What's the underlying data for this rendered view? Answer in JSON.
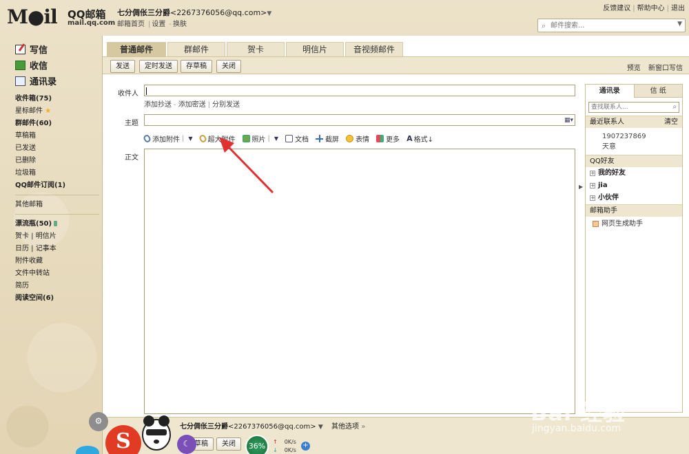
{
  "header": {
    "logo": "M●il",
    "brand_cn": "QQ邮箱",
    "brand_url": "mail.qq.com",
    "account_name": "七分倜伥三分爵",
    "account_email": "<2267376056@qq.com>",
    "account_caret": "▼",
    "links": [
      "邮箱首页",
      "设置",
      "换肤"
    ],
    "top_links": [
      "反馈建议",
      "帮助中心",
      "退出"
    ],
    "search_placeholder": "邮件搜索..."
  },
  "sidebar": {
    "main_actions": [
      {
        "label": "写信",
        "icon": "write-icon"
      },
      {
        "label": "收信",
        "icon": "inbox-icon"
      },
      {
        "label": "通讯录",
        "icon": "contacts-icon"
      }
    ],
    "folders_a": [
      {
        "label": "收件箱(75)",
        "bold": true
      },
      {
        "label": "星标邮件",
        "bold": false,
        "star": true
      },
      {
        "label": "群邮件(60)",
        "bold": true
      },
      {
        "label": "草稿箱",
        "bold": false
      },
      {
        "label": "已发送",
        "bold": false
      },
      {
        "label": "已删除",
        "bold": false
      },
      {
        "label": "垃圾箱",
        "bold": false
      },
      {
        "label": "QQ邮件订阅(1)",
        "bold": true
      }
    ],
    "other_mailbox": "其他邮箱",
    "folders_b": [
      {
        "label": "漂流瓶(50)",
        "bold": true
      },
      {
        "label": "贺卡 | 明信片",
        "bold": false
      },
      {
        "label": "日历 | 记事本",
        "bold": false
      },
      {
        "label": "附件收藏",
        "bold": false
      },
      {
        "label": "文件中转站",
        "bold": false
      },
      {
        "label": "简历",
        "bold": false
      },
      {
        "label": "阅读空间(6)",
        "bold": true
      }
    ]
  },
  "tabs": [
    "普通邮件",
    "群邮件",
    "贺卡",
    "明信片",
    "音视频邮件"
  ],
  "toolbar": {
    "send": "发送",
    "scheduled": "定时发送",
    "save_draft": "存草稿",
    "close": "关闭",
    "preview": "预览",
    "new_window": "新窗口写信"
  },
  "compose": {
    "to_label": "收件人",
    "sub_links": [
      "添加抄送",
      "添加密送",
      "分别发送"
    ],
    "subject_label": "主题",
    "body_label": "正文",
    "tools": [
      {
        "label": "添加附件",
        "icon": "paperclip-icon",
        "caret": true
      },
      {
        "label": "超大附件",
        "icon": "large-attachment-icon",
        "caret": false
      },
      {
        "label": "照片",
        "icon": "photo-icon",
        "caret": true
      },
      {
        "label": "文档",
        "icon": "document-icon",
        "caret": false
      },
      {
        "label": "截屏",
        "icon": "screenshot-icon",
        "caret": false
      },
      {
        "label": "表情",
        "icon": "emoticon-icon",
        "caret": false
      },
      {
        "label": "更多",
        "icon": "more-icon",
        "caret": false
      },
      {
        "label": "格式↓",
        "icon": "format-icon",
        "caret": false
      }
    ]
  },
  "contacts": {
    "tab_contacts": "通讯录",
    "tab_letterhead": "信 纸",
    "search_placeholder": "查找联系人...",
    "recent_title": "最近联系人",
    "clear": "清空",
    "recent": [
      "1907237869",
      "天意"
    ],
    "qq_friends": "QQ好友",
    "groups": [
      "我的好友",
      "jia",
      "小伙伴"
    ],
    "assistant_title": "邮箱助手",
    "assistant_items": [
      "网页生成助手"
    ]
  },
  "bottom": {
    "sender_name": "七分倜伥三分爵",
    "sender_email": "<2267376056@qq.com>",
    "other_options": "其他选项",
    "save_draft": "存草稿",
    "close": "关闭",
    "speed_percent": "36%",
    "up_rate": "0K/s",
    "down_rate": "0K/s"
  },
  "watermark": {
    "text": "Bai 经验",
    "url": "jingyan.baidu.com"
  },
  "colors": {
    "background": "#e8dcc0",
    "toolbar": "#eee6cf",
    "active_tab": "#d6c8a0",
    "arrow": "#e03030"
  }
}
